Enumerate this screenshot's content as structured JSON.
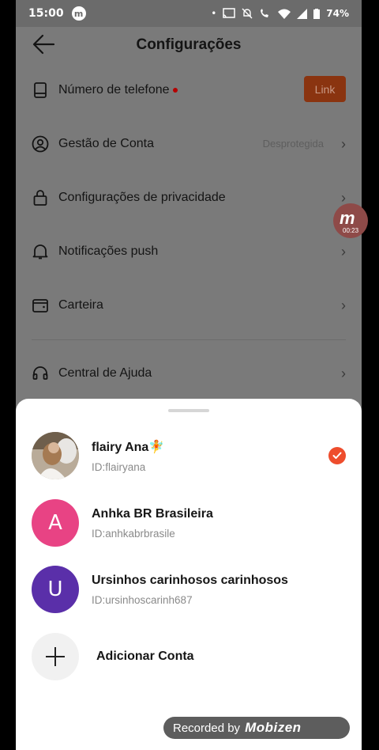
{
  "status_bar": {
    "time": "15:00",
    "battery": "74%"
  },
  "header": {
    "title": "Configurações"
  },
  "settings": {
    "phone": {
      "label": "Número de telefone",
      "button": "Link"
    },
    "account": {
      "label": "Gestão de Conta",
      "status": "Desprotegida"
    },
    "privacy": {
      "label": "Configurações de privacidade"
    },
    "push": {
      "label": "Notificações push"
    },
    "wallet": {
      "label": "Carteira"
    },
    "help": {
      "label": "Central de Ajuda"
    }
  },
  "recorder_bubble": {
    "time": "00:23"
  },
  "account_switcher": {
    "accounts": [
      {
        "name": "flairy Ana🧚",
        "id": "ID:flairyana",
        "selected": true
      },
      {
        "name": "Anhka BR Brasileira",
        "id": "ID:anhkabrbrasile",
        "initial": "A",
        "color": "#e84384"
      },
      {
        "name": "Ursinhos carinhosos carinhosos",
        "id": "ID:ursinhoscarinh687",
        "initial": "U",
        "color": "#5a2fa9"
      }
    ],
    "add_label": "Adicionar Conta"
  },
  "watermark": {
    "prefix": "Recorded by",
    "brand": "Mobizen"
  },
  "colors": {
    "accent": "#ee4d2d",
    "overlay": "#7a7a7a"
  }
}
